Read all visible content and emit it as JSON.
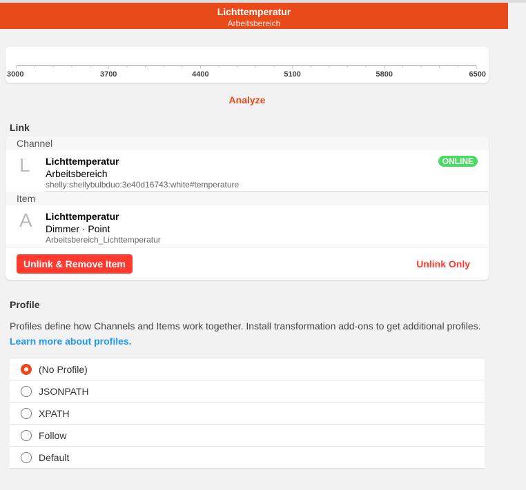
{
  "header": {
    "title": "Lichttemperatur",
    "subtitle": "Arbeitsbereich"
  },
  "scale": {
    "min": 3000,
    "max": 6500,
    "labels": [
      "3000",
      "3700",
      "4400",
      "5100",
      "5800",
      "6500"
    ],
    "minor_per_major": 5
  },
  "analyze_label": "Analyze",
  "link": {
    "heading": "Link",
    "channel_section": "Channel",
    "channel": {
      "icon": "L",
      "title": "Lichttemperatur",
      "subtitle": "Arbeitsbereich",
      "uid": "shelly:shellybulbduo:3e40d16743:white#temperature",
      "status": "ONLINE"
    },
    "item_section": "Item",
    "item": {
      "icon": "A",
      "title": "Lichttemperatur",
      "subtitle": "Dimmer · Point",
      "name": "Arbeitsbereich_Lichttemperatur"
    },
    "unlink_remove_label": "Unlink & Remove Item",
    "unlink_only_label": "Unlink Only"
  },
  "profile": {
    "heading": "Profile",
    "description": "Profiles define how Channels and Items work together. Install transformation add-ons to get additional profiles.",
    "learn_more": "Learn more about profiles.",
    "options": [
      "(No Profile)",
      "JSONPATH",
      "XPATH",
      "Follow",
      "Default"
    ],
    "selected": "(No Profile)"
  },
  "colors": {
    "accent": "#e84a1a",
    "danger": "#ff3b30",
    "online": "#4cd964",
    "link": "#2196f3"
  }
}
